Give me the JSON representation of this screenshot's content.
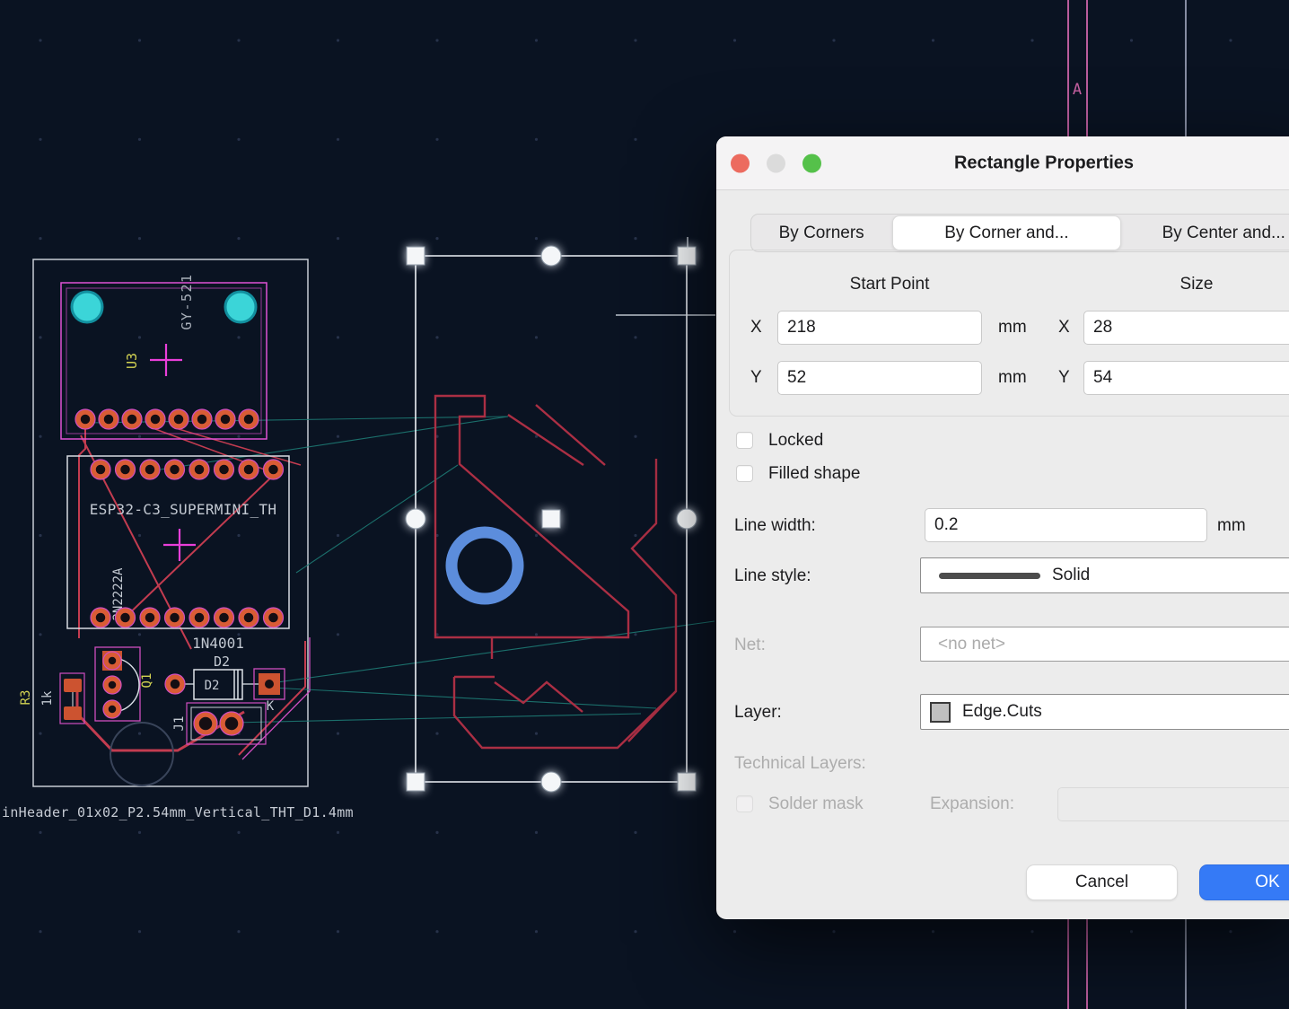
{
  "dialog": {
    "title": "Rectangle Properties",
    "tabs": [
      {
        "label": "By Corners"
      },
      {
        "label": "By Corner and..."
      },
      {
        "label": "By Center and..."
      }
    ],
    "position": {
      "start_point_heading": "Start Point",
      "size_heading": "Size",
      "x_label": "X",
      "y_label": "Y",
      "start_x": "218",
      "start_y": "52",
      "size_x": "28",
      "size_y": "54",
      "unit": "mm"
    },
    "options": {
      "locked": "Locked",
      "filled": "Filled shape"
    },
    "stroke": {
      "line_width_label": "Line width:",
      "line_width_value": "0.2",
      "line_width_unit": "mm",
      "line_style_label": "Line style:",
      "line_style_value": "Solid"
    },
    "net": {
      "label": "Net:",
      "value": "<no net>"
    },
    "layer": {
      "label": "Layer:",
      "value": "Edge.Cuts"
    },
    "technical": {
      "heading": "Technical Layers:",
      "solder_mask": "Solder mask",
      "expansion_label": "Expansion:",
      "expansion_value": ""
    },
    "actions": {
      "cancel": "Cancel",
      "ok": "OK"
    }
  },
  "canvas": {
    "sheet_marker": "A",
    "footer_text": "inHeader_01x02_P2.54mm_Vertical_THT_D1.4mm",
    "components": {
      "u3_ref": "U3",
      "u3_value": "GY-521",
      "esp_value": "ESP32-C3_SUPERMINI_TH",
      "q1_value": "2N2222A",
      "diode_value": "1N4001",
      "d2_ref": "D2",
      "d2_body": "D2",
      "d2_pin": "K",
      "q1_ref": "Q1",
      "j1_ref": "J1",
      "r3_ref": "R3",
      "r3_value": "1k"
    },
    "colors": {
      "background": "#0a1322",
      "edge_cuts_shape": "#ab2f44",
      "copper_trace": "#c33c50",
      "ratsnest": "#1d7a74",
      "silkscreen": "#ccd2da",
      "courtyard": "#cf4ec0",
      "pad": "#d95c35",
      "selection": "#eef2f7",
      "drill_marker": "#5c8ddc",
      "sheet_border": "#b95c9c",
      "mount_hole": "#3bd5d8"
    }
  }
}
